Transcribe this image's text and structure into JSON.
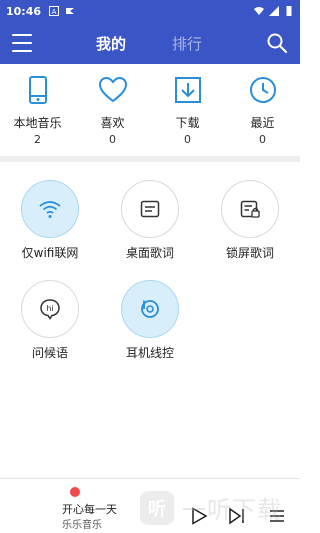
{
  "status_bar": {
    "time": "10:46",
    "left_icons": [
      "notification-a-icon",
      "app-notification-icon"
    ],
    "right_icons": [
      "wifi-icon",
      "signal-icon",
      "battery-icon"
    ]
  },
  "app_bar": {
    "tabs": [
      {
        "label": "我的",
        "active": true
      },
      {
        "label": "排行",
        "active": false
      }
    ]
  },
  "stats": [
    {
      "label": "本地音乐",
      "count": "2",
      "icon": "phone-icon"
    },
    {
      "label": "喜欢",
      "count": "0",
      "icon": "heart-icon"
    },
    {
      "label": "下载",
      "count": "0",
      "icon": "download-icon"
    },
    {
      "label": "最近",
      "count": "0",
      "icon": "clock-icon"
    }
  ],
  "tools": [
    {
      "label": "仅wifi联网",
      "icon": "wifi-icon",
      "active": true
    },
    {
      "label": "桌面歌词",
      "icon": "desktop-lyrics-icon",
      "active": false
    },
    {
      "label": "锁屏歌词",
      "icon": "lockscreen-lyrics-icon",
      "active": false
    },
    {
      "label": "问候语",
      "icon": "greeting-icon",
      "active": false
    },
    {
      "label": "耳机线控",
      "icon": "headphone-control-icon",
      "active": true
    }
  ],
  "player": {
    "title": "开心每一天",
    "artist": "乐乐音乐"
  },
  "colors": {
    "primary": "#3a55c6",
    "icon_blue": "#2a8fd8",
    "active_bg": "#d8eefb",
    "playing_dot": "#f04a4a"
  },
  "watermark": {
    "logo_text": "听",
    "text": "一听下载"
  }
}
